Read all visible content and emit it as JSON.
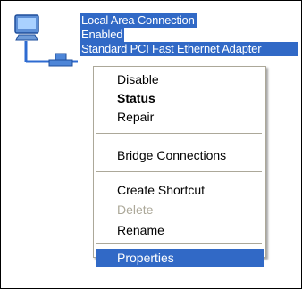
{
  "connection": {
    "name": "Local Area Connection",
    "status": "Enabled",
    "adapter": "Standard PCI Fast Ethernet Adapter",
    "icon": "network-connection-icon"
  },
  "context_menu": {
    "items": [
      {
        "label": "Disable"
      },
      {
        "label": "Status"
      },
      {
        "label": "Repair"
      },
      {
        "label": "Bridge Connections"
      },
      {
        "label": "Create Shortcut"
      },
      {
        "label": "Delete"
      },
      {
        "label": "Rename"
      },
      {
        "label": "Properties"
      }
    ]
  },
  "colors": {
    "selection": "#3169c6",
    "disabled_text": "#aca899",
    "menu_border": "#aca899"
  }
}
